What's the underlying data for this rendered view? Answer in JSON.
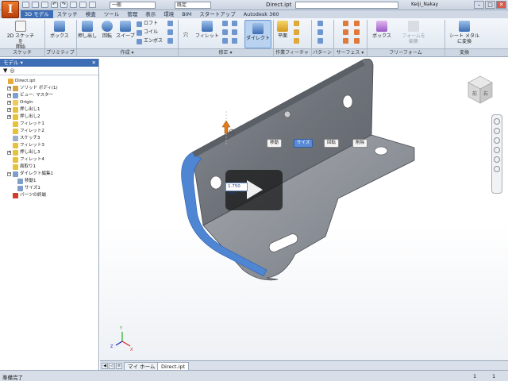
{
  "window": {
    "title": "Direct.ipt",
    "app_letter": "I",
    "material_combo": "一般",
    "appearance_combo": "既定",
    "user": "Keiji_Nakay",
    "min": "–",
    "max": "□",
    "close": "✕"
  },
  "ribbon_tabs": [
    "3D モデル",
    "スケッチ",
    "検査",
    "ツール",
    "管理",
    "表示",
    "環境",
    "BIM",
    "スタートアップ",
    "Autodesk 360"
  ],
  "ribbon": {
    "sketch_btn": "2D スケッチを\n開始",
    "box": "ボックス",
    "extrude": "押し出し",
    "revolve": "回転",
    "sweep": "スイープ",
    "loft": "ロフト",
    "coil": "コイル",
    "emboss": "エンボス",
    "hole": "穴",
    "fillet": "フィレット",
    "direct": "ダイレクト",
    "plane": "平面",
    "freeform_box": "ボックス",
    "form_edit": "フォームを\n編集",
    "sheet_metal": "シート メタル\nに変換"
  },
  "ribbon_groups": {
    "sketch": "スケッチ",
    "primitive": "プリミティブ",
    "create": "作成 ▾",
    "modify": "修正 ▾",
    "work_features": "作業フィーチャ",
    "pattern": "パターン",
    "surface": "サーフェス ▾",
    "freeform": "フリーフォーム",
    "convert": "変換"
  },
  "browser": {
    "title": "モデル ▾",
    "close": "✕",
    "filter_icon": "▼",
    "search_icon": "◎",
    "items": [
      {
        "label": "Direct.ipt",
        "indent": 0,
        "expander": "",
        "color": "#e8a93a"
      },
      {
        "label": "ソリッド ボディ(1)",
        "indent": 1,
        "expander": "+",
        "color": "#d9a23a"
      },
      {
        "label": "ビュー: マスター",
        "indent": 1,
        "expander": "+",
        "color": "#7f9ec9"
      },
      {
        "label": "Origin",
        "indent": 1,
        "expander": "+",
        "color": "#f0c95a"
      },
      {
        "label": "押し出し1",
        "indent": 1,
        "expander": "+",
        "color": "#e5c23a"
      },
      {
        "label": "押し出し2",
        "indent": 1,
        "expander": "+",
        "color": "#e5c23a"
      },
      {
        "label": "フィレット1",
        "indent": 1,
        "expander": "",
        "color": "#e5c23a"
      },
      {
        "label": "フィレット2",
        "indent": 1,
        "expander": "",
        "color": "#e5c23a"
      },
      {
        "label": "スケッチ3",
        "indent": 1,
        "expander": "",
        "color": "#9ab0cf"
      },
      {
        "label": "フィレット3",
        "indent": 1,
        "expander": "",
        "color": "#e5c23a"
      },
      {
        "label": "押し出し3",
        "indent": 1,
        "expander": "+",
        "color": "#e5c23a"
      },
      {
        "label": "フィレット4",
        "indent": 1,
        "expander": "",
        "color": "#e5c23a"
      },
      {
        "label": "面取り1",
        "indent": 1,
        "expander": "",
        "color": "#e5c23a"
      },
      {
        "label": "ダイレクト編集1",
        "indent": 1,
        "expander": "−",
        "color": "#7f9ec9"
      },
      {
        "label": "移動1",
        "indent": 2,
        "expander": "",
        "color": "#7f9ec9"
      },
      {
        "label": "サイズ1",
        "indent": 2,
        "expander": "",
        "color": "#7f9ec9"
      },
      {
        "label": "パーツの終端",
        "indent": 1,
        "expander": "",
        "color": "#d33b2b"
      }
    ]
  },
  "viewport": {
    "mini_toolbar": [
      "移動",
      "サイズ",
      "回転",
      "削除"
    ],
    "mini_toolbar_selected": "サイズ",
    "value_box": "1.750 mm",
    "viewcube_faces": [
      "前",
      "右"
    ],
    "axis_labels": [
      "X",
      "Y",
      "Z"
    ]
  },
  "doc_tabs": {
    "home": "マイ ホーム",
    "active": "Direct.ipt"
  },
  "status": {
    "text": "準備完了",
    "num1": "1",
    "num2": "1"
  }
}
